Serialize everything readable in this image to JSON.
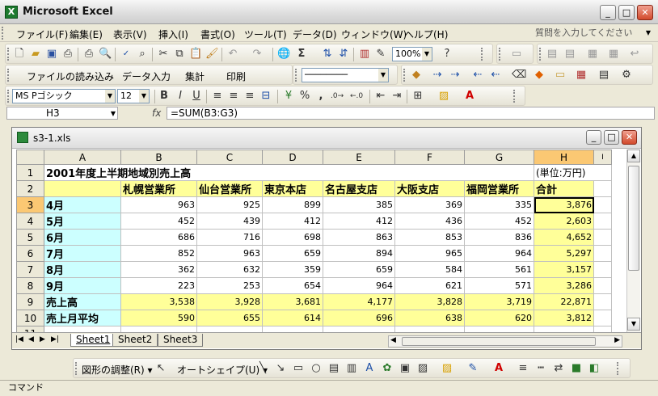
{
  "app": {
    "title": "Microsoft Excel",
    "icon_letter": "X"
  },
  "window_buttons": {
    "minimize": "_",
    "maximize": "□",
    "close": "✕"
  },
  "menu": {
    "items": [
      "ファイル(F)",
      "編集(E)",
      "表示(V)",
      "挿入(I)",
      "書式(O)",
      "ツール(T)",
      "データ(D)",
      "ウィンドウ(W)",
      "ヘルプ(H)"
    ],
    "help_placeholder": "質問を入力してください"
  },
  "toolbar_standard": {
    "zoom": "100%"
  },
  "toolbar_custom": {
    "items": [
      "ファイルの読み込み",
      "データ入力",
      "集計",
      "印刷"
    ]
  },
  "toolbar_format": {
    "font": "MS Pゴシック",
    "size": "12",
    "bold": "B",
    "italic": "I",
    "underline": "U",
    "percent": "%",
    "comma": ","
  },
  "formula_bar": {
    "cell": "H3",
    "fx": "fx",
    "formula": "=SUM(B3:G3)"
  },
  "workbook": {
    "filename": "s3-1.xls",
    "columns": [
      "A",
      "B",
      "C",
      "D",
      "E",
      "F",
      "G",
      "H",
      "I"
    ],
    "rows": [
      {
        "n": "1",
        "cells": [
          "2001年度上半期地域別売上高",
          "",
          "",
          "",
          "",
          "",
          "",
          "(単位:万円)"
        ]
      },
      {
        "n": "2",
        "cells": [
          "",
          "札幌営業所",
          "仙台営業所",
          "東京本店",
          "名古屋支店",
          "大阪支店",
          "福岡営業所",
          "合計"
        ]
      },
      {
        "n": "3",
        "cells": [
          "4月",
          "963",
          "925",
          "899",
          "385",
          "369",
          "335",
          "3,876"
        ]
      },
      {
        "n": "4",
        "cells": [
          "5月",
          "452",
          "439",
          "412",
          "412",
          "436",
          "452",
          "2,603"
        ]
      },
      {
        "n": "5",
        "cells": [
          "6月",
          "686",
          "716",
          "698",
          "863",
          "853",
          "836",
          "4,652"
        ]
      },
      {
        "n": "6",
        "cells": [
          "7月",
          "852",
          "963",
          "659",
          "894",
          "965",
          "964",
          "5,297"
        ]
      },
      {
        "n": "7",
        "cells": [
          "8月",
          "362",
          "632",
          "359",
          "659",
          "584",
          "561",
          "3,157"
        ]
      },
      {
        "n": "8",
        "cells": [
          "9月",
          "223",
          "253",
          "654",
          "964",
          "621",
          "571",
          "3,286"
        ]
      },
      {
        "n": "9",
        "cells": [
          "売上高",
          "3,538",
          "3,928",
          "3,681",
          "4,177",
          "3,828",
          "3,719",
          "22,871"
        ]
      },
      {
        "n": "10",
        "cells": [
          "売上月平均",
          "590",
          "655",
          "614",
          "696",
          "638",
          "620",
          "3,812"
        ]
      },
      {
        "n": "11",
        "cells": [
          "",
          "",
          "",
          "",
          "",
          "",
          "",
          ""
        ]
      }
    ],
    "sheets": [
      "Sheet1",
      "Sheet2",
      "Sheet3"
    ],
    "active_sheet": "Sheet1"
  },
  "drawing_toolbar": {
    "adjust": "図形の調整(R) ▾",
    "autoshape": "オートシェイプ(U) ▾"
  },
  "status": {
    "text": "コマンド"
  }
}
